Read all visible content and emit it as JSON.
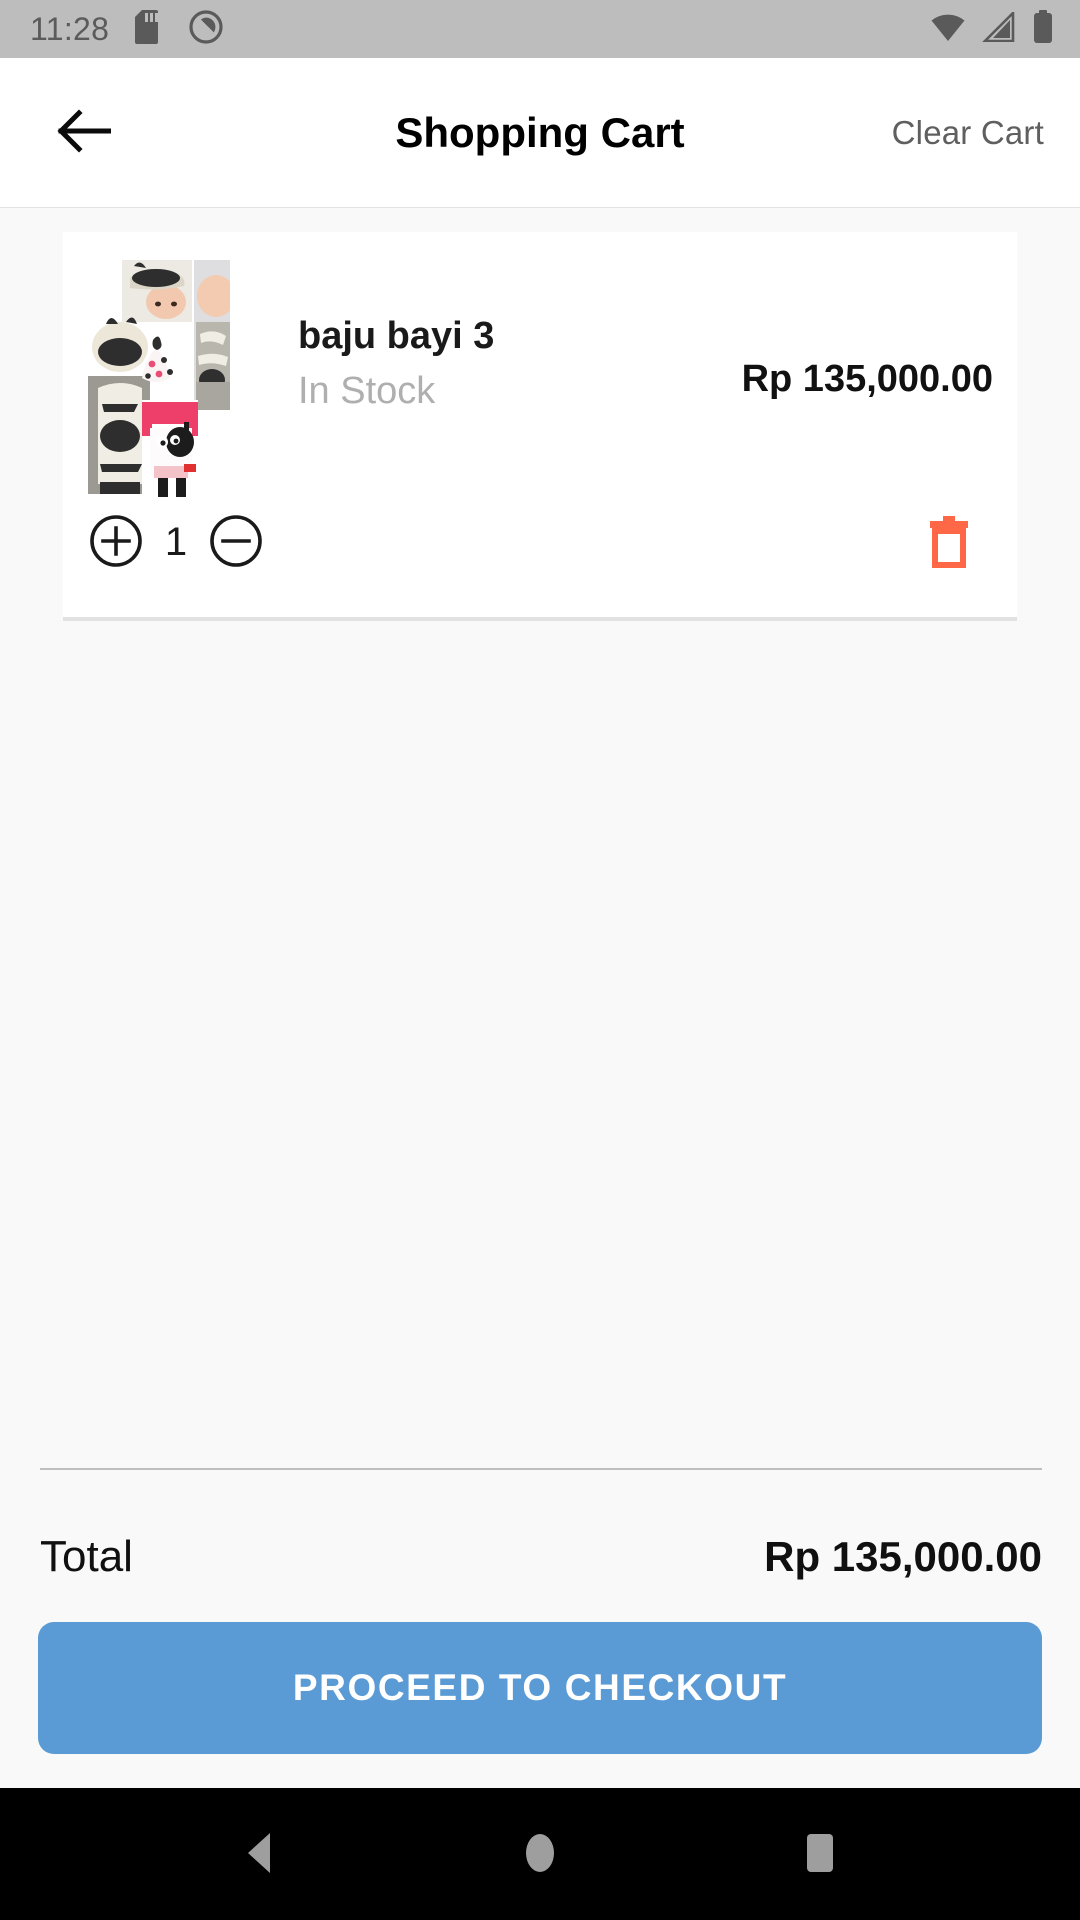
{
  "status_bar": {
    "time": "11:28",
    "icons_left": [
      "sd-card-icon",
      "do-not-disturb-icon"
    ],
    "icons_right": [
      "wifi-icon",
      "cellular-signal-icon",
      "battery-icon"
    ],
    "background_color": "#BDBDBD",
    "foreground_color": "#5A5A5A"
  },
  "app_bar": {
    "back_icon": "back-arrow-icon",
    "title": "Shopping Cart",
    "clear_cart_label": "Clear Cart",
    "clear_cart_color": "#5F5F5F",
    "background_color": "#FFFFFF"
  },
  "cart": {
    "items": [
      {
        "name": "baju bayi 3",
        "stock_status": "In Stock",
        "stock_status_color": "#AFAFAF",
        "price": "Rp 135,000.00",
        "quantity": "1",
        "increase_icon": "plus-circle-icon",
        "decrease_icon": "minus-circle-icon",
        "delete_icon": "trash-icon",
        "delete_icon_color": "#FF6846",
        "thumbnail_alt": "baby-clothing-collage"
      }
    ]
  },
  "footer": {
    "total_label": "Total",
    "total_value": "Rp 135,000.00",
    "checkout_label": "PROCEED TO CHECKOUT",
    "checkout_color": "#5B9BD5"
  },
  "nav_bar": {
    "back_icon": "nav-back-triangle-icon",
    "home_icon": "nav-home-circle-icon",
    "recents_icon": "nav-recents-square-icon",
    "background_color": "#000000",
    "icon_color": "#9E9E9E"
  },
  "theme": {
    "page_background": "#F9F9F9",
    "card_background": "#FFFFFF",
    "divider_color": "#BFBFBF"
  }
}
